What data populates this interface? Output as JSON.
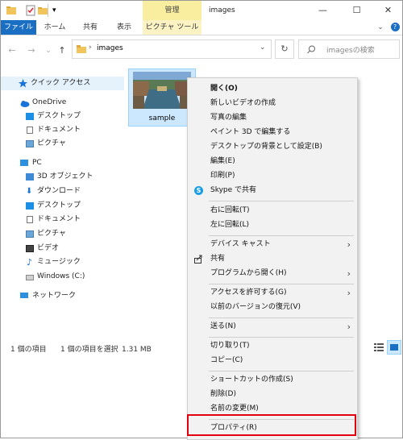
{
  "titlebar": {
    "context_tab": "管理",
    "title": "images",
    "minimize": "—",
    "maximize": "☐",
    "close": "✕",
    "qat_dropdown": "▾"
  },
  "ribbon": {
    "tabs": [
      "ファイル",
      "ホーム",
      "共有",
      "表示",
      "ピクチャ ツール"
    ],
    "expand": "⌄",
    "help": "?"
  },
  "address": {
    "back": "←",
    "forward": "→",
    "recent": "⌄",
    "up": "↑",
    "sep": "›",
    "path": "images",
    "dropdown": "⌄",
    "refresh": "↻",
    "search_placeholder": "imagesの検索"
  },
  "nav": {
    "quick_access": "クイック アクセス",
    "onedrive": "OneDrive",
    "onedrive_items": [
      "デスクトップ",
      "ドキュメント",
      "ピクチャ"
    ],
    "pc": "PC",
    "pc_items": [
      "3D オブジェクト",
      "ダウンロード",
      "デスクトップ",
      "ドキュメント",
      "ピクチャ",
      "ビデオ",
      "ミュージック",
      "Windows (C:)"
    ],
    "network": "ネットワーク"
  },
  "file": {
    "name": "sample"
  },
  "status": {
    "count": "1 個の項目",
    "selected": "1 個の項目を選択",
    "size": "1.31 MB"
  },
  "menu": {
    "g1": [
      "開く(O)",
      "新しいビデオの作成",
      "写真の編集",
      "ペイント 3D で編集する",
      "デスクトップの背景として設定(B)",
      "編集(E)",
      "印刷(P)",
      "Skype で共有"
    ],
    "g2": [
      "右に回転(T)",
      "左に回転(L)"
    ],
    "cast": "デバイス キャスト",
    "share": "共有",
    "open_with": "プログラムから開く(H)",
    "access": "アクセスを許可する(G)",
    "restore": "以前のバージョンの復元(V)",
    "send_to": "送る(N)",
    "cut": "切り取り(T)",
    "copy": "コピー(C)",
    "shortcut": "ショートカットの作成(S)",
    "delete": "削除(D)",
    "rename": "名前の変更(M)",
    "properties": "プロパティ(R)",
    "arrow": "›"
  },
  "colors": {
    "accent": "#1a6fc2",
    "highlight": "#e2000f",
    "selection": "#cce8ff",
    "context_tab": "#f9ee9f"
  }
}
